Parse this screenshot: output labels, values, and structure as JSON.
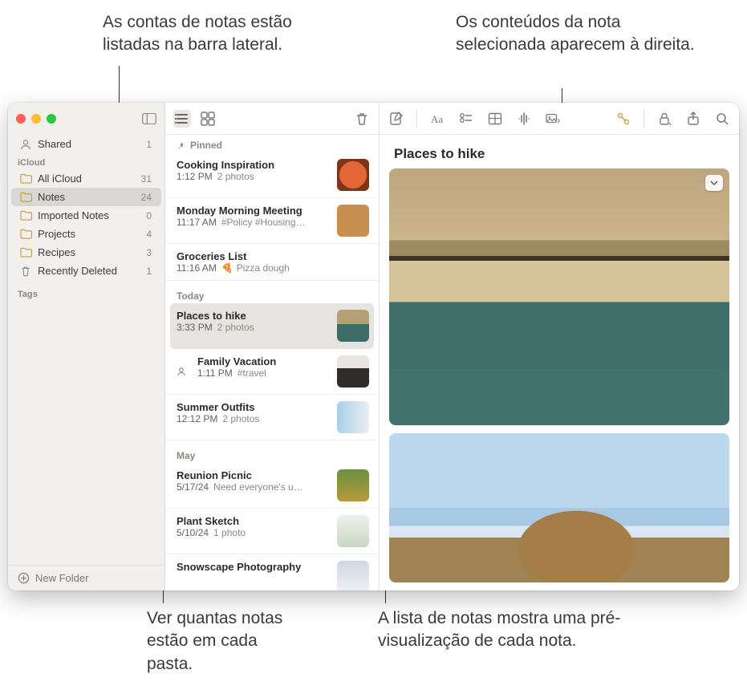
{
  "callouts": {
    "top_left": "As contas de notas estão listadas na barra lateral.",
    "top_right": "Os conteúdos da nota selecionada aparecem à direita.",
    "bottom_left": "Ver quantas notas estão em cada pasta.",
    "bottom_right": "A lista de notas mostra uma pré-visualização de cada nota."
  },
  "sidebar": {
    "shared": {
      "label": "Shared",
      "count": "1"
    },
    "account_label": "iCloud",
    "items": [
      {
        "label": "All iCloud",
        "count": "31"
      },
      {
        "label": "Notes",
        "count": "24"
      },
      {
        "label": "Imported Notes",
        "count": "0"
      },
      {
        "label": "Projects",
        "count": "4"
      },
      {
        "label": "Recipes",
        "count": "3"
      },
      {
        "label": "Recently Deleted",
        "count": "1"
      }
    ],
    "tags_label": "Tags",
    "new_folder": "New Folder"
  },
  "noteslist": {
    "pinned_label": "Pinned",
    "pinned": [
      {
        "title": "Cooking Inspiration",
        "time": "1:12 PM",
        "sub": "2 photos"
      },
      {
        "title": "Monday Morning Meeting",
        "time": "11:17 AM",
        "sub": "#Policy #Housing…"
      },
      {
        "title": "Groceries List",
        "time": "11:16 AM",
        "sub": "Pizza dough"
      }
    ],
    "today_label": "Today",
    "today": [
      {
        "title": "Places to hike",
        "time": "3:33 PM",
        "sub": "2 photos",
        "selected": true
      },
      {
        "title": "Family Vacation",
        "time": "1:11 PM",
        "sub": "#travel",
        "shared": true
      },
      {
        "title": "Summer Outfits",
        "time": "12:12 PM",
        "sub": "2 photos"
      }
    ],
    "may_label": "May",
    "may": [
      {
        "title": "Reunion Picnic",
        "time": "5/17/24",
        "sub": "Need everyone's u…"
      },
      {
        "title": "Plant Sketch",
        "time": "5/10/24",
        "sub": "1 photo"
      },
      {
        "title": "Snowscape Photography",
        "time": "",
        "sub": ""
      }
    ]
  },
  "editor": {
    "title": "Places to hike"
  }
}
